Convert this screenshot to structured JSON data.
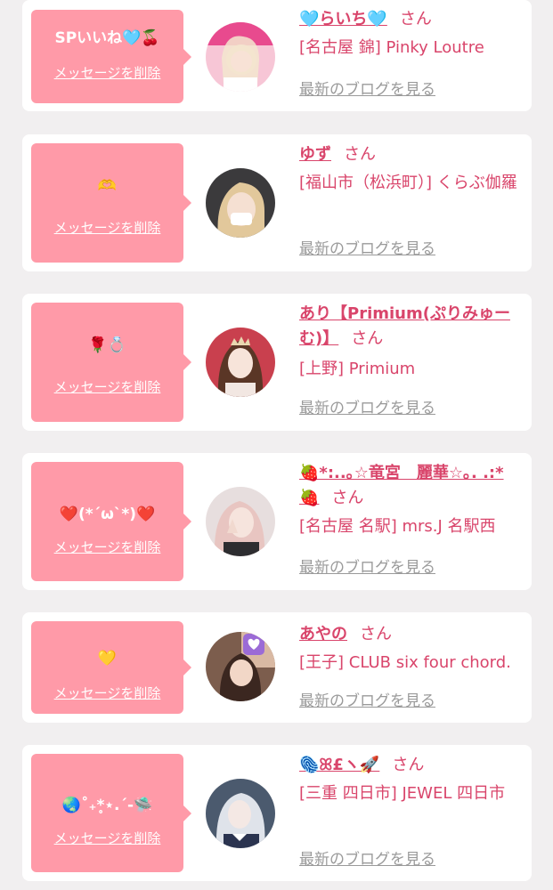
{
  "common": {
    "delete_label": "メッセージを削除",
    "san_label": "さん",
    "blog_label": "最新のブログを見る"
  },
  "cards": [
    {
      "message": "SPいいね🩵🍒",
      "name": "🩵らいち🩵",
      "shop": "[名古屋 錦] Pinky Loutre"
    },
    {
      "message": "🫶",
      "name": "ゆず",
      "shop": "[福山市（松浜町）] くらぶ伽羅"
    },
    {
      "message": "🌹💍",
      "name": "あり【Primium(ぷりみゅーむ)】",
      "shop": "[上野] Primium"
    },
    {
      "message": "❤️(*´ω`*)❤️",
      "name": "🍓*:..｡☆竜宮　麗華☆｡. .:*🍓",
      "shop": "[名古屋 名駅] mrs.J 名駅西"
    },
    {
      "message": "💛",
      "name": "あやの",
      "shop": "[王子] CLUB six four chord."
    },
    {
      "message": "🌏˚₊*̥⋆.ˊ-🛸",
      "name": "🫆ꕤ£ヽ🚀",
      "shop": "[三重 四日市] JEWEL 四日市"
    }
  ],
  "colors": {
    "background": "#f1eff0",
    "bubble": "#ff9aa8",
    "accent": "#d9456b",
    "link_gray": "#9a9a9a"
  }
}
